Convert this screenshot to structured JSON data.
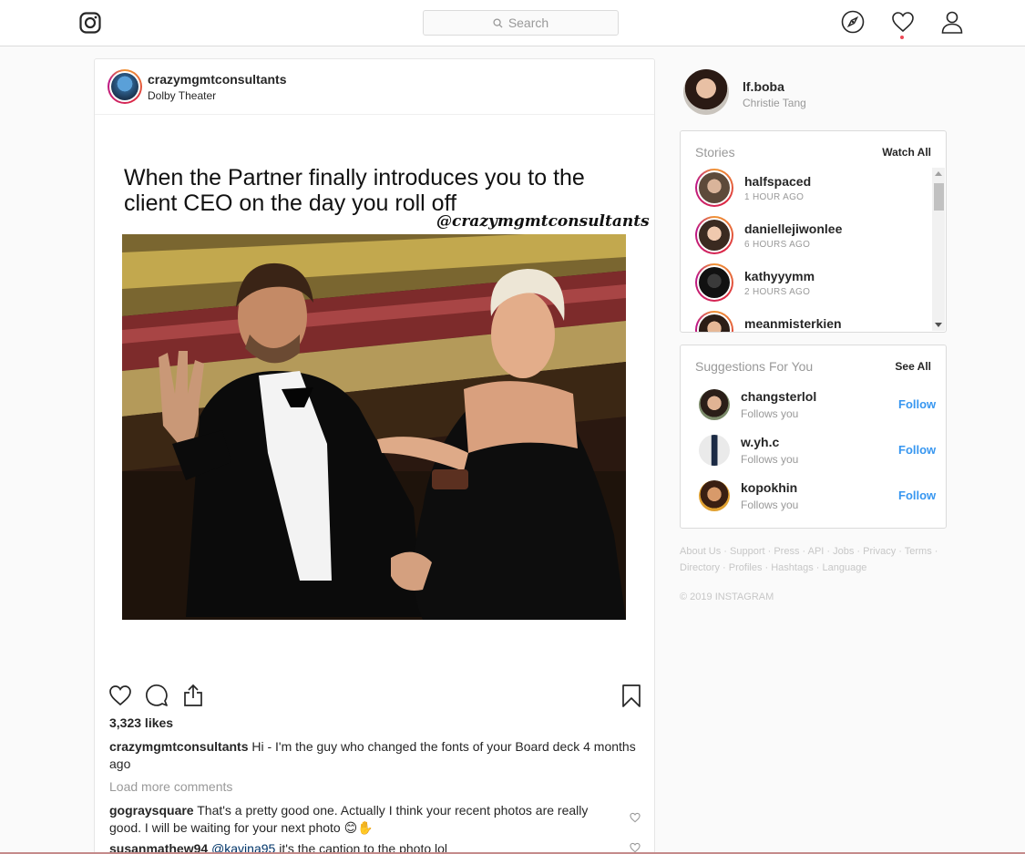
{
  "header": {
    "search_placeholder": "Search",
    "icons": [
      "instagram-logo-icon",
      "search-icon",
      "compass-icon",
      "heart-icon",
      "profile-icon"
    ],
    "notification_dot_color": "#ed4956"
  },
  "post": {
    "username": "crazymgmtconsultants",
    "location": "Dolby Theater",
    "meme_title": "When the Partner finally introduces you to the client CEO on the day you roll off",
    "meme_handle": "@crazymgmtconsultants",
    "likes": "3,323 likes",
    "caption_user": "crazymgmtconsultants",
    "caption_text": "Hi - I'm the guy who changed the fonts of your Board deck 4 months ago",
    "load_more": "Load more comments",
    "comments": [
      {
        "user": "gograysquare",
        "text": "That's a pretty good one. Actually I think your recent photos are really good. I will be waiting for your next photo 😊✋"
      },
      {
        "user": "susanmathew94",
        "mention": "@kavina95",
        "text": "it's the caption to the photo lol"
      }
    ]
  },
  "sidebar": {
    "me": {
      "username": "lf.boba",
      "name": "Christie Tang"
    },
    "stories": {
      "title": "Stories",
      "link": "Watch All",
      "items": [
        {
          "username": "halfspaced",
          "time": "1 HOUR AGO"
        },
        {
          "username": "daniellejiwonlee",
          "time": "6 HOURS AGO"
        },
        {
          "username": "kathyyymm",
          "time": "2 HOURS AGO"
        },
        {
          "username": "meanmisterkien",
          "time": ""
        }
      ]
    },
    "suggestions": {
      "title": "Suggestions For You",
      "link": "See All",
      "items": [
        {
          "username": "changsterlol",
          "sub": "Follows you",
          "action": "Follow"
        },
        {
          "username": "w.yh.c",
          "sub": "Follows you",
          "action": "Follow"
        },
        {
          "username": "kopokhin",
          "sub": "Follows you",
          "action": "Follow"
        }
      ]
    },
    "footer_links": "About Us · Support · Press · API · Jobs · Privacy · Terms · Directory · Profiles · Hashtags · Language",
    "copyright": "© 2019 INSTAGRAM"
  },
  "colors": {
    "accent": "#3897f0",
    "border": "#dbdbdb",
    "muted": "#999999"
  }
}
